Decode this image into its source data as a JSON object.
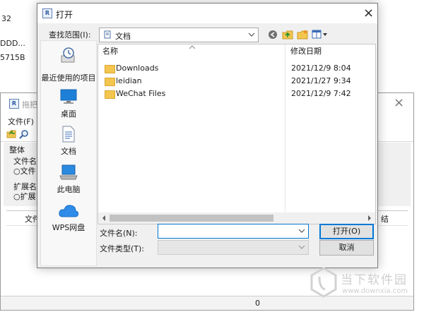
{
  "background": {
    "fragments": [
      "32",
      "DDD...",
      "5715B"
    ],
    "app_window": {
      "title": "拖把",
      "menu_file": "文件(F)",
      "section_whole": "整体",
      "file_name_label": "文件名",
      "file_radio_label": "○文件",
      "ext_label": "扩展名",
      "ext_radio_label": "○扩展",
      "column_file": "文件",
      "column_right": "结",
      "status_count": "0"
    }
  },
  "dialog": {
    "title": "打开",
    "look_in_label": "查找范围(I):",
    "look_in_value": "文档",
    "places": [
      {
        "label": "最近使用的项目"
      },
      {
        "label": "桌面"
      },
      {
        "label": "文档"
      },
      {
        "label": "此电脑"
      },
      {
        "label": "WPS网盘"
      }
    ],
    "columns": {
      "name": "名称",
      "date": "修改日期"
    },
    "files": [
      {
        "name": "Downloads",
        "date": "2021/12/9 8:04"
      },
      {
        "name": "leidian",
        "date": "2021/1/27 9:34"
      },
      {
        "name": "WeChat Files",
        "date": "2021/12/9 7:42"
      }
    ],
    "filename_label": "文件名(N):",
    "filename_value": "",
    "filetype_label": "文件类型(T):",
    "filetype_value": "",
    "open_button": "打开(O)",
    "cancel_button": "取消"
  },
  "watermark": {
    "text": "当下软件园",
    "url": "www.downxia.com"
  },
  "colors": {
    "accent": "#0078d7",
    "folder": "#f4c64f"
  }
}
